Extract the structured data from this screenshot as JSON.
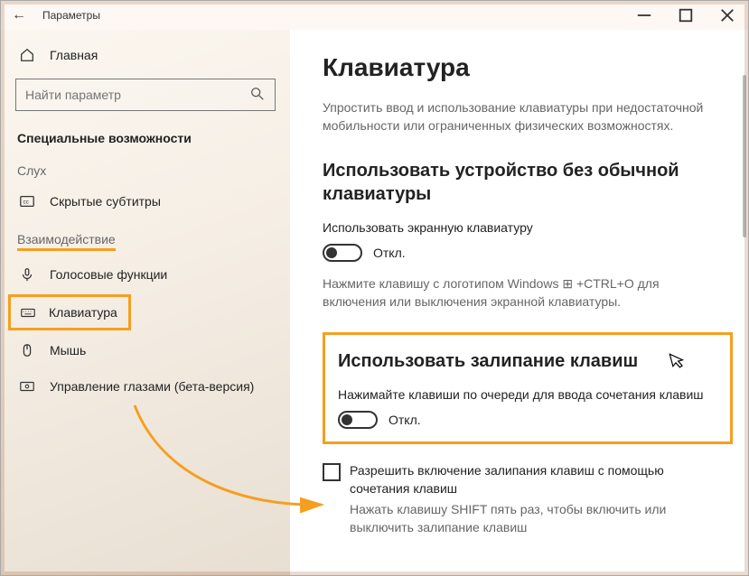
{
  "window": {
    "title": "Параметры"
  },
  "sidebar": {
    "home_label": "Главная",
    "search_placeholder": "Найти параметр",
    "category_title": "Специальные возможности",
    "group_hearing": "Слух",
    "group_interaction": "Взаимодействие",
    "items": {
      "closed_captions": "Скрытые субтитры",
      "speech": "Голосовые функции",
      "keyboard": "Клавиатура",
      "mouse": "Мышь",
      "eye_control": "Управление глазами (бета-версия)"
    }
  },
  "content": {
    "title": "Клавиатура",
    "intro": "Упростить ввод и использование клавиатуры при недостаточной мобильности или ограниченных физических возможностях.",
    "osk": {
      "heading": "Использовать устройство без обычной клавиатуры",
      "label": "Использовать экранную клавиатуру",
      "state": "Откл.",
      "hint": "Нажмите клавишу с логотипом Windows ⊞ +CTRL+O для включения или выключения экранной клавиатуры."
    },
    "sticky": {
      "heading": "Использовать залипание клавиш",
      "label": "Нажимайте клавиши по очереди для ввода сочетания клавиш",
      "state": "Откл.",
      "checkbox_label": "Разрешить включение залипания клавиш с помощью сочетания клавиш",
      "checkbox_hint": "Нажать клавишу SHIFT пять раз, чтобы включить или выключить залипание клавиш"
    }
  }
}
